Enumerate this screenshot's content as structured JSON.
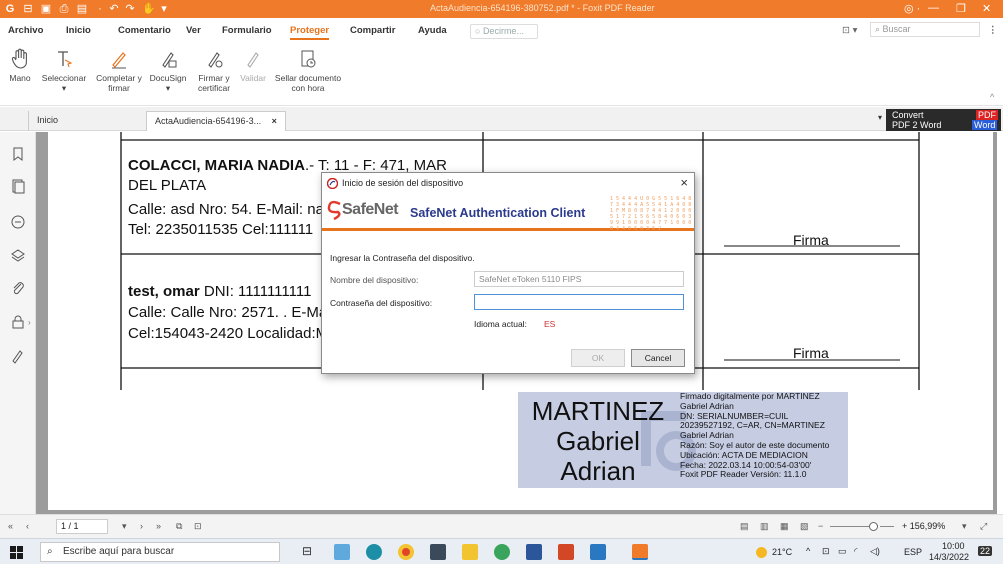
{
  "window": {
    "title": "ActaAudiencia-654196-380752.pdf * - Foxit PDF Reader"
  },
  "menu": {
    "items": [
      "Archivo",
      "Inicio",
      "Comentario",
      "Ver",
      "Formulario",
      "Proteger",
      "Compartir",
      "Ayuda"
    ],
    "active": "Proteger",
    "tell_me_placeholder": "Decirme...",
    "search_placeholder": "Buscar"
  },
  "ribbon": {
    "buttons": [
      {
        "label": "Mano"
      },
      {
        "label": "Seleccionar"
      },
      {
        "label": "Completar y firmar"
      },
      {
        "label": "DocuSign"
      },
      {
        "label": "Firmar y certificar"
      },
      {
        "label": "Validar"
      },
      {
        "label": "Sellar documento con hora"
      }
    ]
  },
  "tabs": {
    "home": "Inicio",
    "document": "ActaAudiencia-654196-3...",
    "convert_line1": "Convert",
    "convert_line2": "PDF 2 Word",
    "convert_badge1": "PDF",
    "convert_badge2": "Word"
  },
  "document": {
    "row1": {
      "name": "COLACCI, MARIA NADIA",
      "line1_rest": ".- T: 11 - F: 471, MAR",
      "line2": "DEL PLATA",
      "line3": "Calle: asd Nro: 54. E-Mail: na",
      "line4": "Tel: 2235011535 Cel:111111",
      "firma": "Firma"
    },
    "row2": {
      "name": "test, omar",
      "line1_rest": " DNI: 1111111111",
      "line2": "Calle: Calle Nro: 2571. . E-Ma",
      "line3": "Cel:154043-2420 Localidad:M",
      "firma": "Firma"
    },
    "signature": {
      "name_line1": "MARTINEZ",
      "name_line2": "Gabriel",
      "name_line3": "Adrian",
      "details": "Firmado digitalmente por MARTINEZ\nGabriel Adrian\nDN: SERIALNUMBER=CUIL\n20239527192, C=AR, CN=MARTINEZ\nGabriel Adrian\nRazón: Soy el autor de este documento\nUbicación: ACTA DE MEDIACION\nFecha: 2022.03.14 10:00:54-03'00'\nFoxit PDF Reader Versión: 11.1.0"
    }
  },
  "dialog": {
    "title": "Inicio de sesión del dispositivo",
    "logo_text": "SafeNet",
    "product": "SafeNet Authentication Client",
    "decor_digits": "1 5 4 4 4 U 0 G 5 5 1 6 4 8 7 3 4 4 4 A 5 5 4 1 A 4 0 8 1 F M 8 0 8 7 4 4 1 2 0 0 0 5 1 7 2 1 5 6 5 8 4 0 6 0 3 9 9 1 0 0 0 0 4 7 7 1 0 0 0 0 4 4 0 6 0 3 6 2",
    "instruction": "Ingresar la Contraseña del dispositivo.",
    "device_name_label": "Nombre del dispositivo:",
    "device_name_value": "SafeNet eToken 5110 FIPS",
    "password_label": "Contraseña del dispositivo:",
    "password_value": "",
    "language_label": "Idioma actual:",
    "language_value": "ES",
    "ok_label": "OK",
    "cancel_label": "Cancel"
  },
  "statusbar": {
    "page": "1 / 1",
    "zoom": "+ 156,99%"
  },
  "taskbar": {
    "search_placeholder": "Escribe aquí para buscar",
    "weather": "21°C",
    "language": "ESP",
    "time": "10:00",
    "date": "14/3/2022",
    "notification_count": "22"
  },
  "colors": {
    "foxit_orange": "#f07b2a",
    "safenet_blue": "#2b3a8c",
    "signature_bg": "#c6cde3"
  }
}
